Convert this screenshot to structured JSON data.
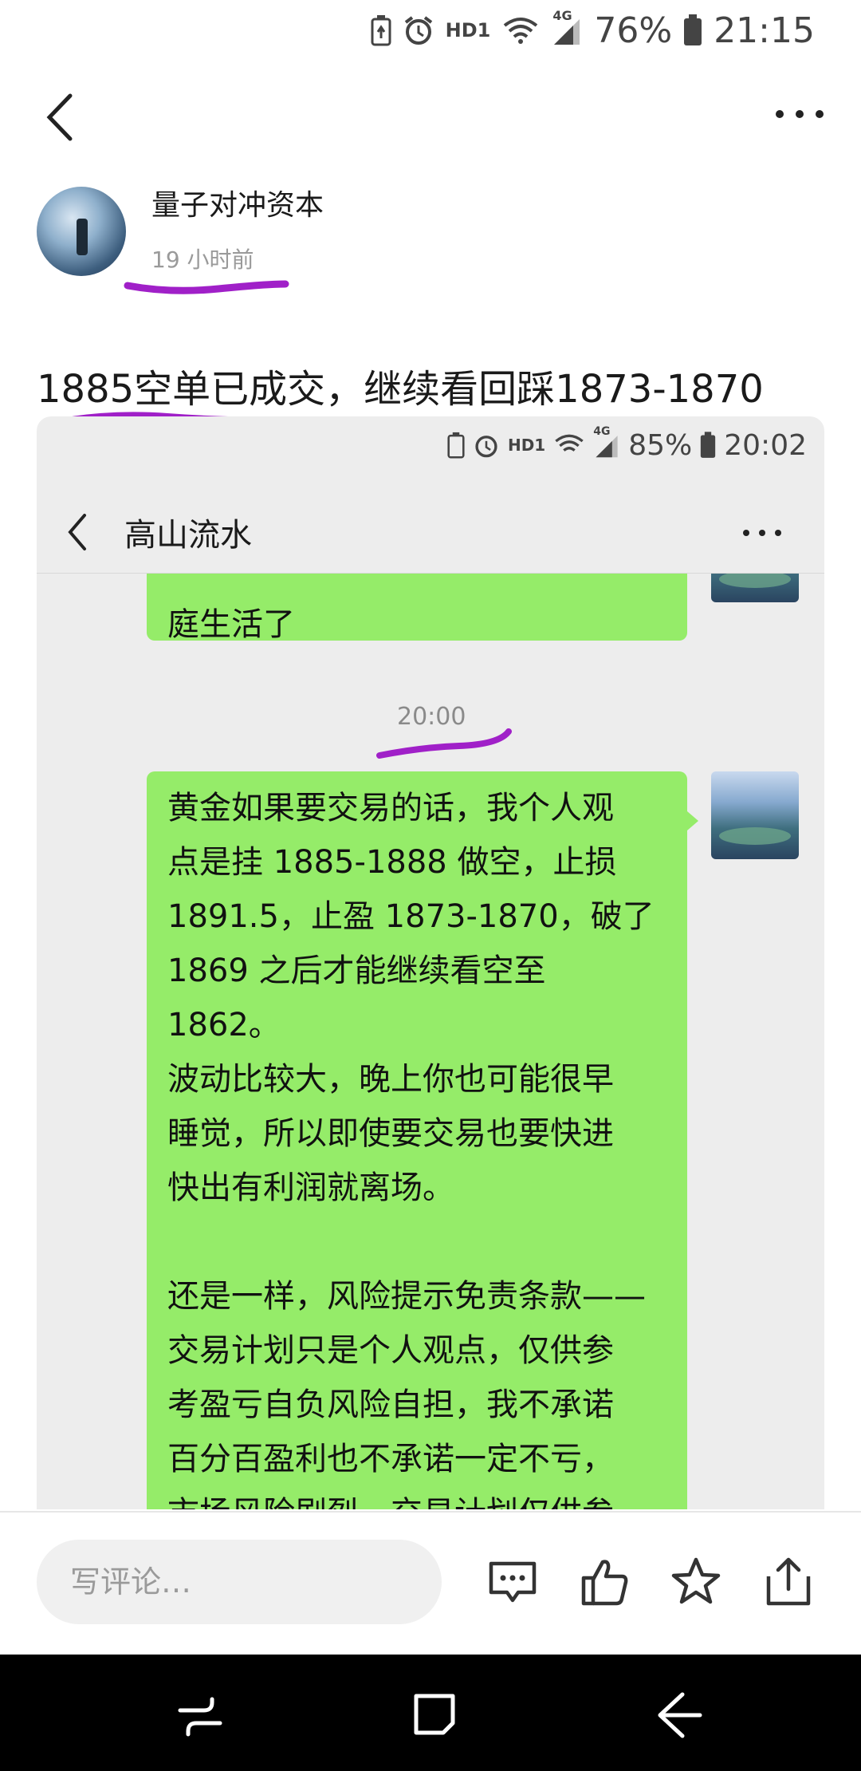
{
  "status_bar": {
    "hd": "HD1",
    "net": "4G",
    "battery": "76%",
    "time": "21:15"
  },
  "post": {
    "author": "量子对冲资本",
    "time": "19 小时前",
    "text": "1885空单已成交，继续看回踩1873-1870"
  },
  "embedded": {
    "status": {
      "hd": "HD1",
      "net": "4G",
      "battery": "85%",
      "time": "20:02"
    },
    "chat_title": "高山流水",
    "partial_bubble_text": "庭生活了",
    "timestamp": "20:00",
    "message_lines": [
      "黄金如果要交易的话，我个人观",
      "点是挂 1885-1888 做空，止损",
      "1891.5，止盈 1873-1870，破了",
      "1869 之后才能继续看空至 1862。",
      "波动比较大，晚上你也可能很早",
      "睡觉，所以即使要交易也要快进",
      "快出有利润就离场。",
      "",
      "还是一样，风险提示免责条款——",
      "交易计划只是个人观点，仅供参",
      "考盈亏自负风险自担，我不承诺",
      "百分百盈利也不承诺一定不亏，",
      "市场风险剧烈，交易计划仅供参"
    ],
    "highlight_color": "#a020c8",
    "bubble_color": "#95ec69"
  },
  "comment_bar": {
    "placeholder": "写评论…",
    "icons": [
      "comment-icon",
      "like-icon",
      "star-icon",
      "share-icon"
    ]
  },
  "nav_bar": {
    "icons": [
      "recent-apps-icon",
      "home-icon",
      "back-icon"
    ]
  }
}
